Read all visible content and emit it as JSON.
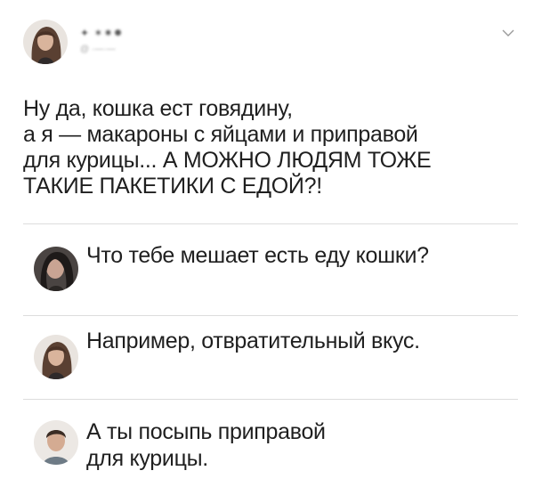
{
  "tweet": {
    "author_name": "✦ ✶✷✸",
    "author_handle": "@ ·—·—",
    "text_lines": [
      "Ну да, кошка ест говядину,",
      "а я — макароны с яйцами и приправой",
      "для курицы... А МОЖНО ЛЮДЯМ ТОЖЕ",
      "ТАКИЕ ПАКЕТИКИ С ЕДОЙ?!"
    ]
  },
  "replies": [
    {
      "lines": [
        "Что тебе мешает есть еду кошки?"
      ]
    },
    {
      "lines": [
        "Например, отвратительный вкус."
      ]
    },
    {
      "lines": [
        "А ты посыпь приправой",
        "для курицы."
      ]
    }
  ],
  "icons": {
    "menu": "chevron-down-icon",
    "author_avatar": "avatar",
    "reply_avatars": [
      "avatar",
      "avatar",
      "avatar"
    ]
  },
  "colors": {
    "text": "#1f1f1f",
    "divider": "#dcdcdc",
    "background": "#ffffff"
  }
}
